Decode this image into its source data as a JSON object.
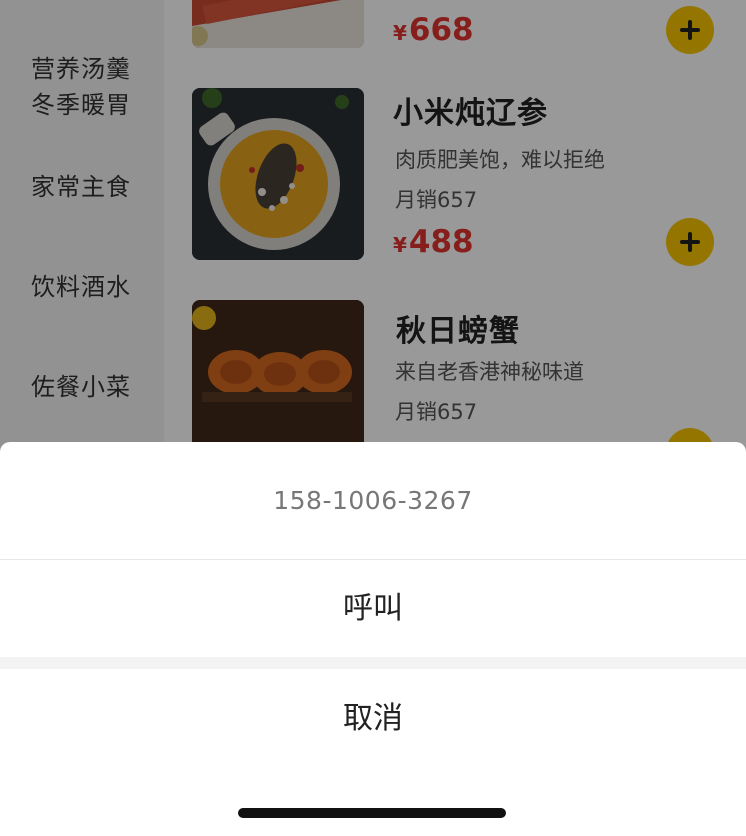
{
  "sidebar": {
    "categories": [
      {
        "label": "营养汤羹\n冬季暖胃"
      },
      {
        "label": "家常主食"
      },
      {
        "label": "饮料酒水"
      },
      {
        "label": "佐餐小菜"
      }
    ]
  },
  "dishes": [
    {
      "name": "",
      "desc": "",
      "sales": "",
      "currency": "¥",
      "price": "668"
    },
    {
      "name": "小米炖辽参",
      "desc": "肉质肥美饱，难以拒绝",
      "sales": "月销657",
      "currency": "¥",
      "price": "488"
    },
    {
      "name": "秋日螃蟹",
      "desc": "来自老香港神秘味道",
      "sales": "月销657",
      "currency": "¥",
      "price": ""
    }
  ],
  "action_sheet": {
    "phone": "158-1006-3267",
    "call_label": "呼叫",
    "cancel_label": "取消"
  },
  "colors": {
    "accent": "#f7c400",
    "price": "#e0332e"
  }
}
